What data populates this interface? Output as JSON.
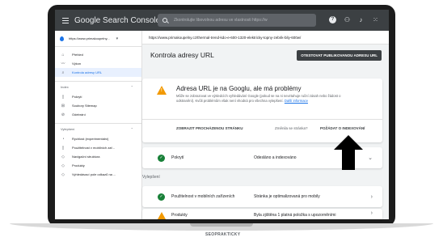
{
  "app": {
    "brand": "Google Search Console",
    "search_placeholder": "Zkontrolujte libovolnou adresu ve vlastnosti https://w",
    "help_icon": "?"
  },
  "sidebar": {
    "property": "https://www.primakoupelny...",
    "nav": [
      {
        "label": "Přehled",
        "icon": "home-icon"
      },
      {
        "label": "Výkon",
        "icon": "trend-icon"
      },
      {
        "label": "Kontrola adresy URL",
        "icon": "search-icon",
        "active": true
      }
    ],
    "index_label": "Index",
    "index_items": [
      {
        "label": "Pokrytí",
        "icon": "file-icon"
      },
      {
        "label": "Soubory Sitemap",
        "icon": "sitemap-icon"
      },
      {
        "label": "Odebrání",
        "icon": "remove-icon"
      }
    ],
    "improvements_label": "Vylepšení",
    "improvements_items": [
      {
        "label": "Rychlost (experimentální)",
        "icon": "speed-icon"
      },
      {
        "label": "Použitelnost v mobilních zař...",
        "icon": "mobile-icon"
      },
      {
        "label": "Navigační struktura",
        "icon": "diamond-icon"
      },
      {
        "label": "Produkty",
        "icon": "diamond-icon"
      },
      {
        "label": "Vyhledávací pole odkazů na ...",
        "icon": "diamond-icon"
      }
    ]
  },
  "main": {
    "url": "https://www.primakoupelny.cz/thermal-trend-kdo-e-600-1320-elektricky-topny-zebrik-bily-600w/",
    "title": "Kontrola adresy URL",
    "test_button": "OTESTOVAT PUBLIKOVANOU ADRESU URL",
    "status": {
      "title": "Adresa URL je na Googlu, ale má problémy",
      "body": "Může se zobrazovat ve výsledcích vyhledávání Google (pokud se na ni nevztahuje ruční zásah nebo žádost o odstranění). Kvůli problémům však není vhodná pro všechna vylepšení.",
      "more_link": "Další informace",
      "inspect_link": "ZOBRAZIT PROCHÁZENOU STRÁNKU",
      "changed_question": "Změnila se stránka?",
      "request_link": "POŽÁDAT O INDEXOVÁNÍ"
    },
    "coverage": {
      "label": "Pokrytí",
      "value": "Odesláno a indexováno"
    },
    "improvements_heading": "Vylepšení",
    "mobile": {
      "label": "Použitelnost v mobilních zařízeních",
      "value": "Stránka je optimalizovaná pro mobily"
    },
    "products": {
      "label": "Produkty",
      "value": "Byla zjištěna 1 platná položka s upozorněními"
    }
  },
  "footer_logo": "SEOPRAKTICKY"
}
